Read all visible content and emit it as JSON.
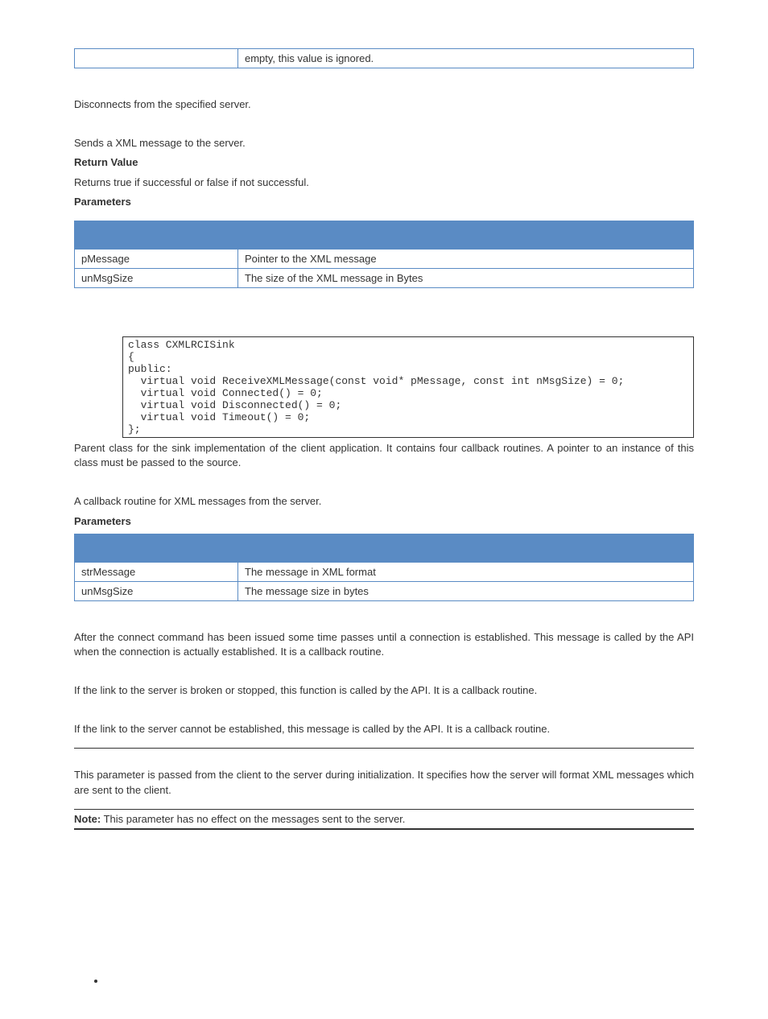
{
  "trailing_row": {
    "name": "",
    "desc": "empty, this value is ignored."
  },
  "section1": {
    "disconnect_desc": "Disconnects from the specified server.",
    "send_desc": "Sends a XML message to the server.",
    "return_label": "Return Value",
    "return_desc": "Returns true if successful or false if not successful.",
    "params_label": "Parameters",
    "params": [
      {
        "name": "pMessage",
        "desc": "Pointer to the XML message"
      },
      {
        "name": "unMsgSize",
        "desc": "The size of the XML message in Bytes"
      }
    ]
  },
  "code": "class CXMLRCISink\n{\npublic:\n  virtual void ReceiveXMLMessage(const void* pMessage, const int nMsgSize) = 0;\n  virtual void Connected() = 0;\n  virtual void Disconnected() = 0;\n  virtual void Timeout() = 0;\n};",
  "section2": {
    "class_desc": "Parent class for the sink implementation of the client application. It contains four callback routines. A pointer to an instance of this class must be passed to the source.",
    "callback_desc": "A callback routine for XML messages from the server.",
    "params_label": "Parameters",
    "params": [
      {
        "name": "strMessage",
        "desc": "The message in XML format"
      },
      {
        "name": "unMsgSize",
        "desc": "The message size in bytes"
      }
    ],
    "connected_desc": "After the connect command has been issued some time passes until a connection is established. This message is called by the API when the connection is actually established. It is a callback routine.",
    "disconnected_desc": "If the link to the server is broken or stopped, this function is called by the API. It is a callback routine.",
    "timeout_desc": "If the link to the server cannot be established, this message is called by the API. It is a callback routine.",
    "format_desc": "This parameter is passed from the client to the server during initialization. It specifies how the server will format XML messages which are sent to the client."
  },
  "note": {
    "label": "Note:",
    "text": " This parameter has no effect on the messages sent to the server."
  }
}
